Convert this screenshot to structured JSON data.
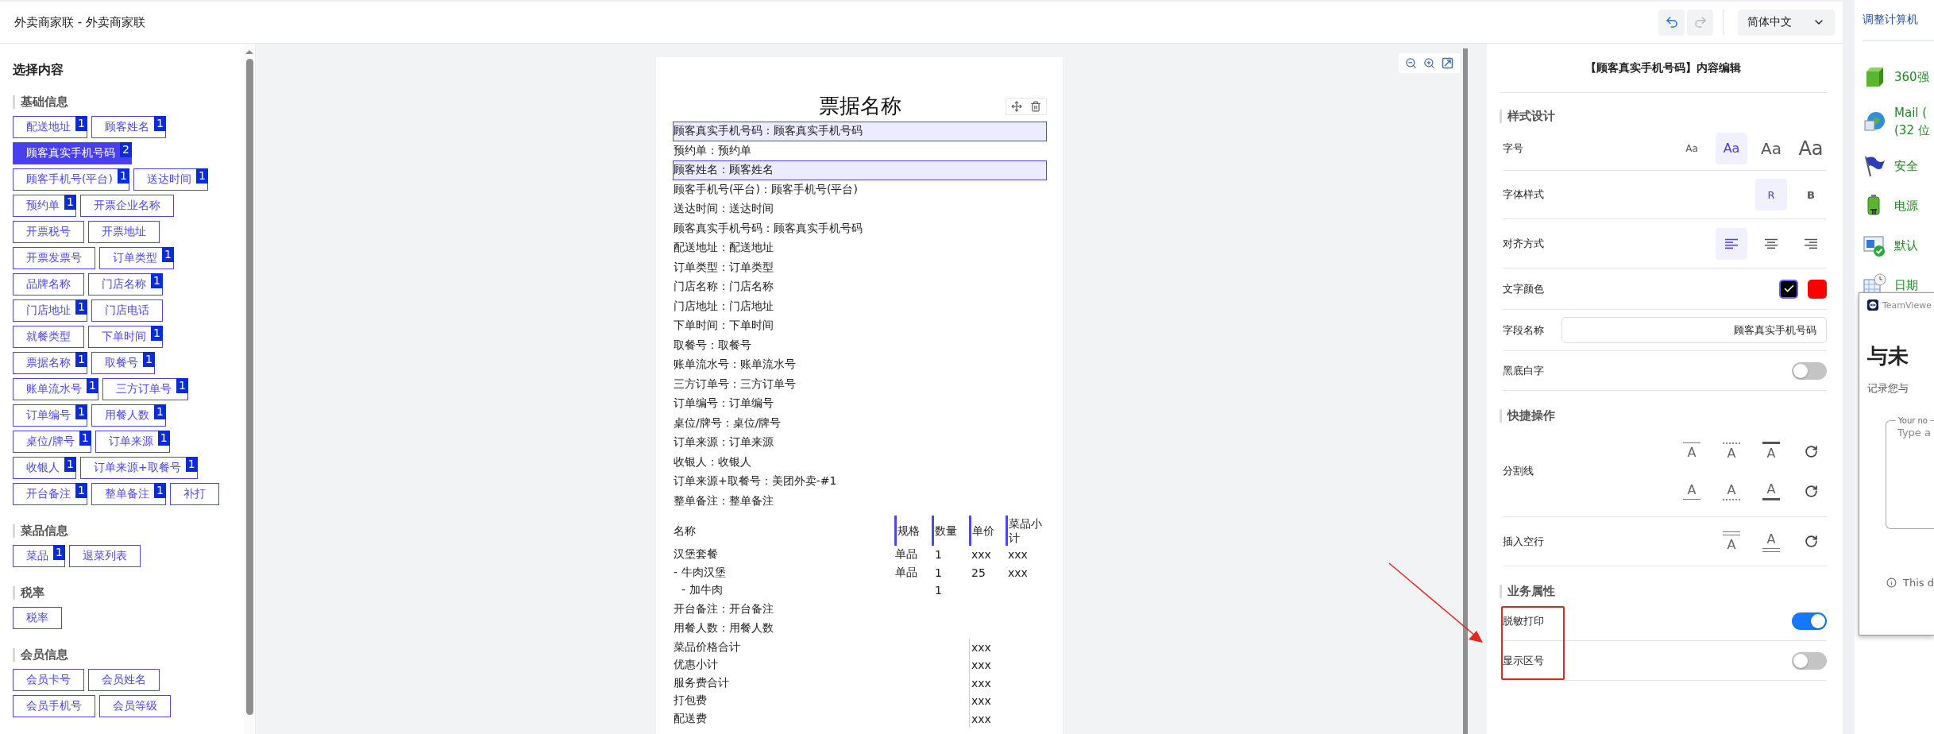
{
  "window": {
    "title": "外卖商家联 - 外卖商家联"
  },
  "toolbar": {
    "undo": {
      "disabled": false
    },
    "redo": {
      "disabled": true
    },
    "language": "简体中文"
  },
  "left_panel": {
    "title": "选择内容",
    "sections": [
      {
        "title": "基础信息",
        "tags": [
          {
            "label": "配送地址",
            "count": "1",
            "selected": false
          },
          {
            "label": "顾客姓名",
            "count": "1",
            "selected": false
          },
          {
            "label": "顾客真实手机号码",
            "count": "2",
            "selected": true
          },
          {
            "label": "顾客手机号(平台)",
            "count": "1",
            "selected": false
          },
          {
            "label": "送达时间",
            "count": "1",
            "selected": false
          },
          {
            "label": "预约单",
            "count": "1",
            "selected": false
          },
          {
            "label": "开票企业名称",
            "selected": false
          },
          {
            "label": "开票税号",
            "selected": false
          },
          {
            "label": "开票地址",
            "selected": false
          },
          {
            "label": "开票发票号",
            "selected": false
          },
          {
            "label": "订单类型",
            "count": "1",
            "selected": false
          },
          {
            "label": "品牌名称",
            "selected": false
          },
          {
            "label": "门店名称",
            "count": "1",
            "selected": false
          },
          {
            "label": "门店地址",
            "count": "1",
            "selected": false
          },
          {
            "label": "门店电话",
            "selected": false
          },
          {
            "label": "就餐类型",
            "selected": false
          },
          {
            "label": "下单时间",
            "count": "1",
            "selected": false
          },
          {
            "label": "票据名称",
            "count": "1",
            "selected": false
          },
          {
            "label": "取餐号",
            "count": "1",
            "selected": false
          },
          {
            "label": "账单流水号",
            "count": "1",
            "selected": false
          },
          {
            "label": "三方订单号",
            "count": "1",
            "selected": false
          },
          {
            "label": "订单编号",
            "count": "1",
            "selected": false
          },
          {
            "label": "用餐人数",
            "count": "1",
            "selected": false
          },
          {
            "label": "桌位/牌号",
            "count": "1",
            "selected": false
          },
          {
            "label": "订单来源",
            "count": "1",
            "selected": false
          },
          {
            "label": "收银人",
            "count": "1",
            "selected": false
          },
          {
            "label": "订单来源+取餐号",
            "count": "1",
            "selected": false
          },
          {
            "label": "开台备注",
            "count": "1",
            "selected": false
          },
          {
            "label": "整单备注",
            "count": "1",
            "selected": false
          },
          {
            "label": "补打",
            "selected": false
          }
        ]
      },
      {
        "title": "菜品信息",
        "tags": [
          {
            "label": "菜品",
            "count": "1",
            "selected": false
          },
          {
            "label": "退菜列表",
            "selected": false
          }
        ]
      },
      {
        "title": "税率",
        "tags": [
          {
            "label": "税率",
            "selected": false
          }
        ]
      },
      {
        "title": "会员信息",
        "tags": [
          {
            "label": "会员卡号",
            "selected": false
          },
          {
            "label": "会员姓名",
            "selected": false
          },
          {
            "label": "会员手机号",
            "selected": false
          },
          {
            "label": "会员等级",
            "selected": false
          }
        ]
      }
    ]
  },
  "receipt": {
    "title": "票据名称",
    "lines": [
      {
        "text": "顾客真实手机号码：顾客真实手机号码",
        "selected": true
      },
      {
        "text": "预约单：预约单",
        "selected": false
      },
      {
        "text": "顾客姓名：顾客姓名",
        "selected": true
      },
      {
        "text": "顾客手机号(平台)：顾客手机号(平台)",
        "selected": false
      },
      {
        "text": "送达时间：送达时间",
        "selected": false
      },
      {
        "text": "顾客真实手机号码：顾客真实手机号码",
        "selected": false
      },
      {
        "text": "配送地址：配送地址",
        "selected": false
      },
      {
        "text": "订单类型：订单类型",
        "selected": false
      },
      {
        "text": "门店名称：门店名称",
        "selected": false
      },
      {
        "text": "门店地址：门店地址",
        "selected": false
      },
      {
        "text": "下单时间：下单时间",
        "selected": false
      },
      {
        "text": "取餐号：取餐号",
        "selected": false
      },
      {
        "text": "账单流水号：账单流水号",
        "selected": false
      },
      {
        "text": "三方订单号：三方订单号",
        "selected": false
      },
      {
        "text": "订单编号：订单编号",
        "selected": false
      },
      {
        "text": "桌位/牌号：桌位/牌号",
        "selected": false
      },
      {
        "text": "订单来源：订单来源",
        "selected": false
      },
      {
        "text": "收银人：收银人",
        "selected": false
      },
      {
        "text": "订单来源+取餐号：美团外卖-#1",
        "selected": false
      },
      {
        "text": "整单备注：整单备注",
        "selected": false
      }
    ],
    "table": {
      "columns": [
        "名称",
        "规格",
        "数量",
        "单价",
        "菜品小计"
      ],
      "items": [
        {
          "name": "汉堡套餐",
          "spec": "单品",
          "qty": "1",
          "price": "xxx",
          "subtotal": "xxx",
          "children": [
            {
              "name": "- 牛肉汉堡",
              "spec": "单品",
              "qty": "1",
              "price": "25",
              "subtotal": "xxx",
              "children": [
                {
                  "name": "- 加牛肉",
                  "qty": "1"
                }
              ]
            }
          ]
        }
      ]
    },
    "after_lines": [
      "开台备注：开台备注",
      "用餐人数：用餐人数"
    ],
    "totals": [
      {
        "label": "菜品价格合计",
        "value": "xxx"
      },
      {
        "label": "优惠小计",
        "value": "xxx"
      },
      {
        "label": "服务费合计",
        "value": "xxx"
      },
      {
        "label": "打包费",
        "value": "xxx"
      },
      {
        "label": "配送费",
        "value": "xxx"
      }
    ]
  },
  "editor": {
    "title": "【顾客真实手机号码】内容编辑",
    "sections": [
      {
        "title": "样式设计",
        "rows": [
          {
            "kind": "sizes",
            "label": "字号",
            "options": [
              {
                "label": "Aa",
                "selected": false
              },
              {
                "label": "Aa",
                "selected": true
              },
              {
                "label": "Aa",
                "selected": false
              },
              {
                "label": "Aa",
                "selected": false
              }
            ]
          },
          {
            "kind": "weights",
            "label": "字体样式",
            "options": [
              {
                "label": "R",
                "selected": true
              },
              {
                "label": "B",
                "selected": false
              }
            ]
          },
          {
            "kind": "align",
            "label": "对齐方式",
            "options": [
              {
                "kind": "left",
                "selected": true
              },
              {
                "kind": "center",
                "selected": false
              },
              {
                "kind": "right",
                "selected": false
              }
            ]
          },
          {
            "kind": "colors",
            "label": "文字颜色",
            "swatches": [
              {
                "color": "#000000",
                "selected": true
              },
              {
                "color": "#ff0000",
                "selected": false
              }
            ]
          },
          {
            "kind": "input",
            "label": "字段名称",
            "value": "顾客真实手机号码"
          },
          {
            "kind": "toggle",
            "label": "黑底白字",
            "on": false
          }
        ]
      },
      {
        "title": "快捷操作",
        "rows": [
          {
            "kind": "dividers",
            "label": "分割线",
            "groups": [
              {
                "options": [
                  {
                    "label": "A",
                    "kind": "solid-over"
                  },
                  {
                    "label": "A",
                    "kind": "dotted-over"
                  },
                  {
                    "label": "A",
                    "kind": "thick-over"
                  }
                ]
              },
              {
                "options": [
                  {
                    "label": "A",
                    "kind": "solid-under"
                  },
                  {
                    "label": "A",
                    "kind": "dotted-under"
                  },
                  {
                    "label": "A",
                    "kind": "thick-under"
                  }
                ]
              }
            ]
          },
          {
            "kind": "blank",
            "label": "插入空行",
            "options": [
              {
                "label": "A",
                "kind": "over"
              },
              {
                "label": "A",
                "kind": "under"
              }
            ]
          }
        ]
      },
      {
        "title": "业务属性",
        "annotated": true,
        "rows": [
          {
            "kind": "toggle",
            "label": "脱敏打印",
            "on": true
          },
          {
            "kind": "toggle",
            "label": "显示区号",
            "on": false
          }
        ]
      }
    ]
  },
  "background_window": {
    "link": "调整计算机",
    "items": [
      {
        "lines": [
          "360强"
        ]
      },
      {
        "lines": [
          "Mail (",
          "(32 位"
        ]
      },
      {
        "lines": [
          "安全"
        ]
      },
      {
        "lines": [
          "电源"
        ]
      },
      {
        "lines": [
          "默认"
        ]
      },
      {
        "lines": [
          "日期"
        ]
      }
    ]
  },
  "popup": {
    "app": "TeamViewe",
    "heading": "与未",
    "subtitle": "记录您与",
    "notes_label": "Your no",
    "placeholder": "Type a",
    "footer": "This d"
  }
}
